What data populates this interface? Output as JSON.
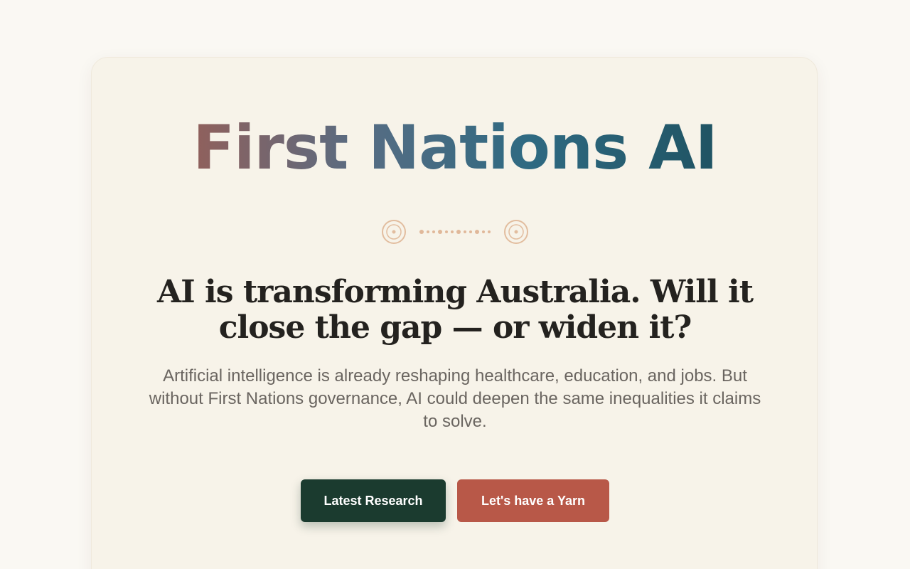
{
  "brand": {
    "title": "First Nations AI"
  },
  "hero": {
    "headline": "AI is transforming Australia. Will it close the gap — or widen it?",
    "subcopy": "Artificial intelligence is already reshaping healthcare, education, and jobs. But without First Nations governance, AI could deepen the same inequalities it claims to solve."
  },
  "actions": {
    "research_label": "Latest Research",
    "yarn_label": "Let's have a Yarn"
  },
  "colors": {
    "background": "#faf8f3",
    "card": "#f7f3e9",
    "primary_dark_green": "#1b3b2f",
    "terracotta": "#b85848",
    "ornament": "#e0b89a",
    "heading_text": "#24221f",
    "body_text": "#6a6560"
  },
  "ornament": {
    "icons": [
      "concentric-circle-icon",
      "dot-line-icon",
      "concentric-circle-icon"
    ]
  }
}
